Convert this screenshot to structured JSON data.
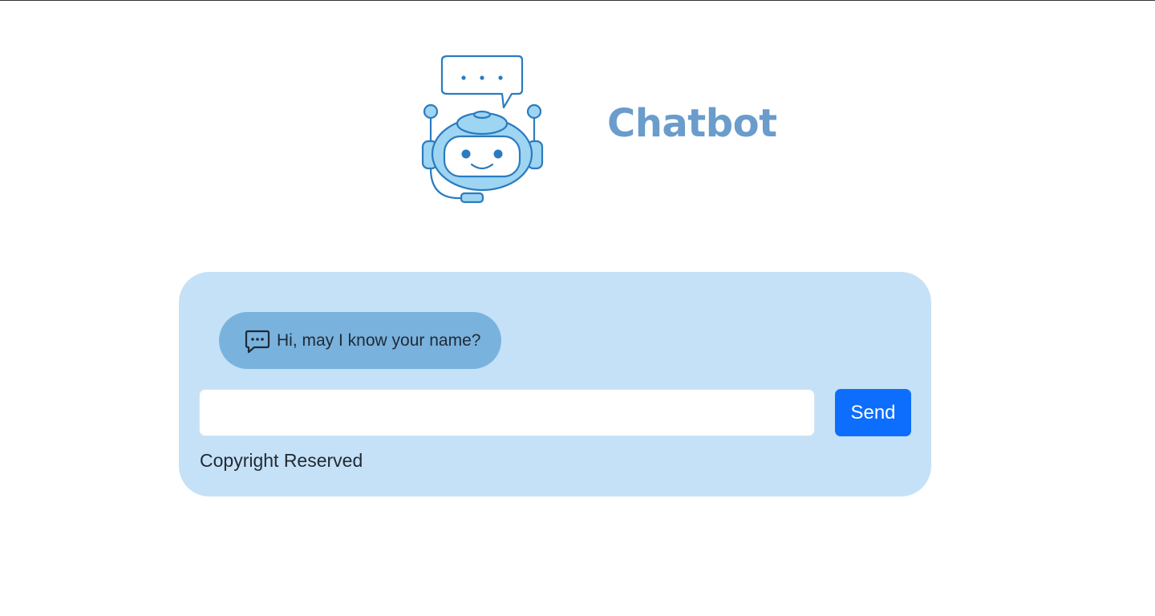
{
  "header": {
    "logo_icon": "robot-chat-icon",
    "title": "Chatbot"
  },
  "chat": {
    "messages": [
      {
        "sender": "bot",
        "icon": "chat-dots-icon",
        "text": "Hi, may I know your name?"
      }
    ],
    "input": {
      "value": "",
      "placeholder": ""
    },
    "send_label": "Send",
    "footer": "Copyright Reserved"
  },
  "colors": {
    "title": "#6a9ccc",
    "card_background": "#c5e1f7",
    "bot_bubble": "#79b2dd",
    "send_button": "#0d6efd",
    "icon_stroke": "#2b7bbf",
    "icon_fill": "#9ed5f2"
  }
}
